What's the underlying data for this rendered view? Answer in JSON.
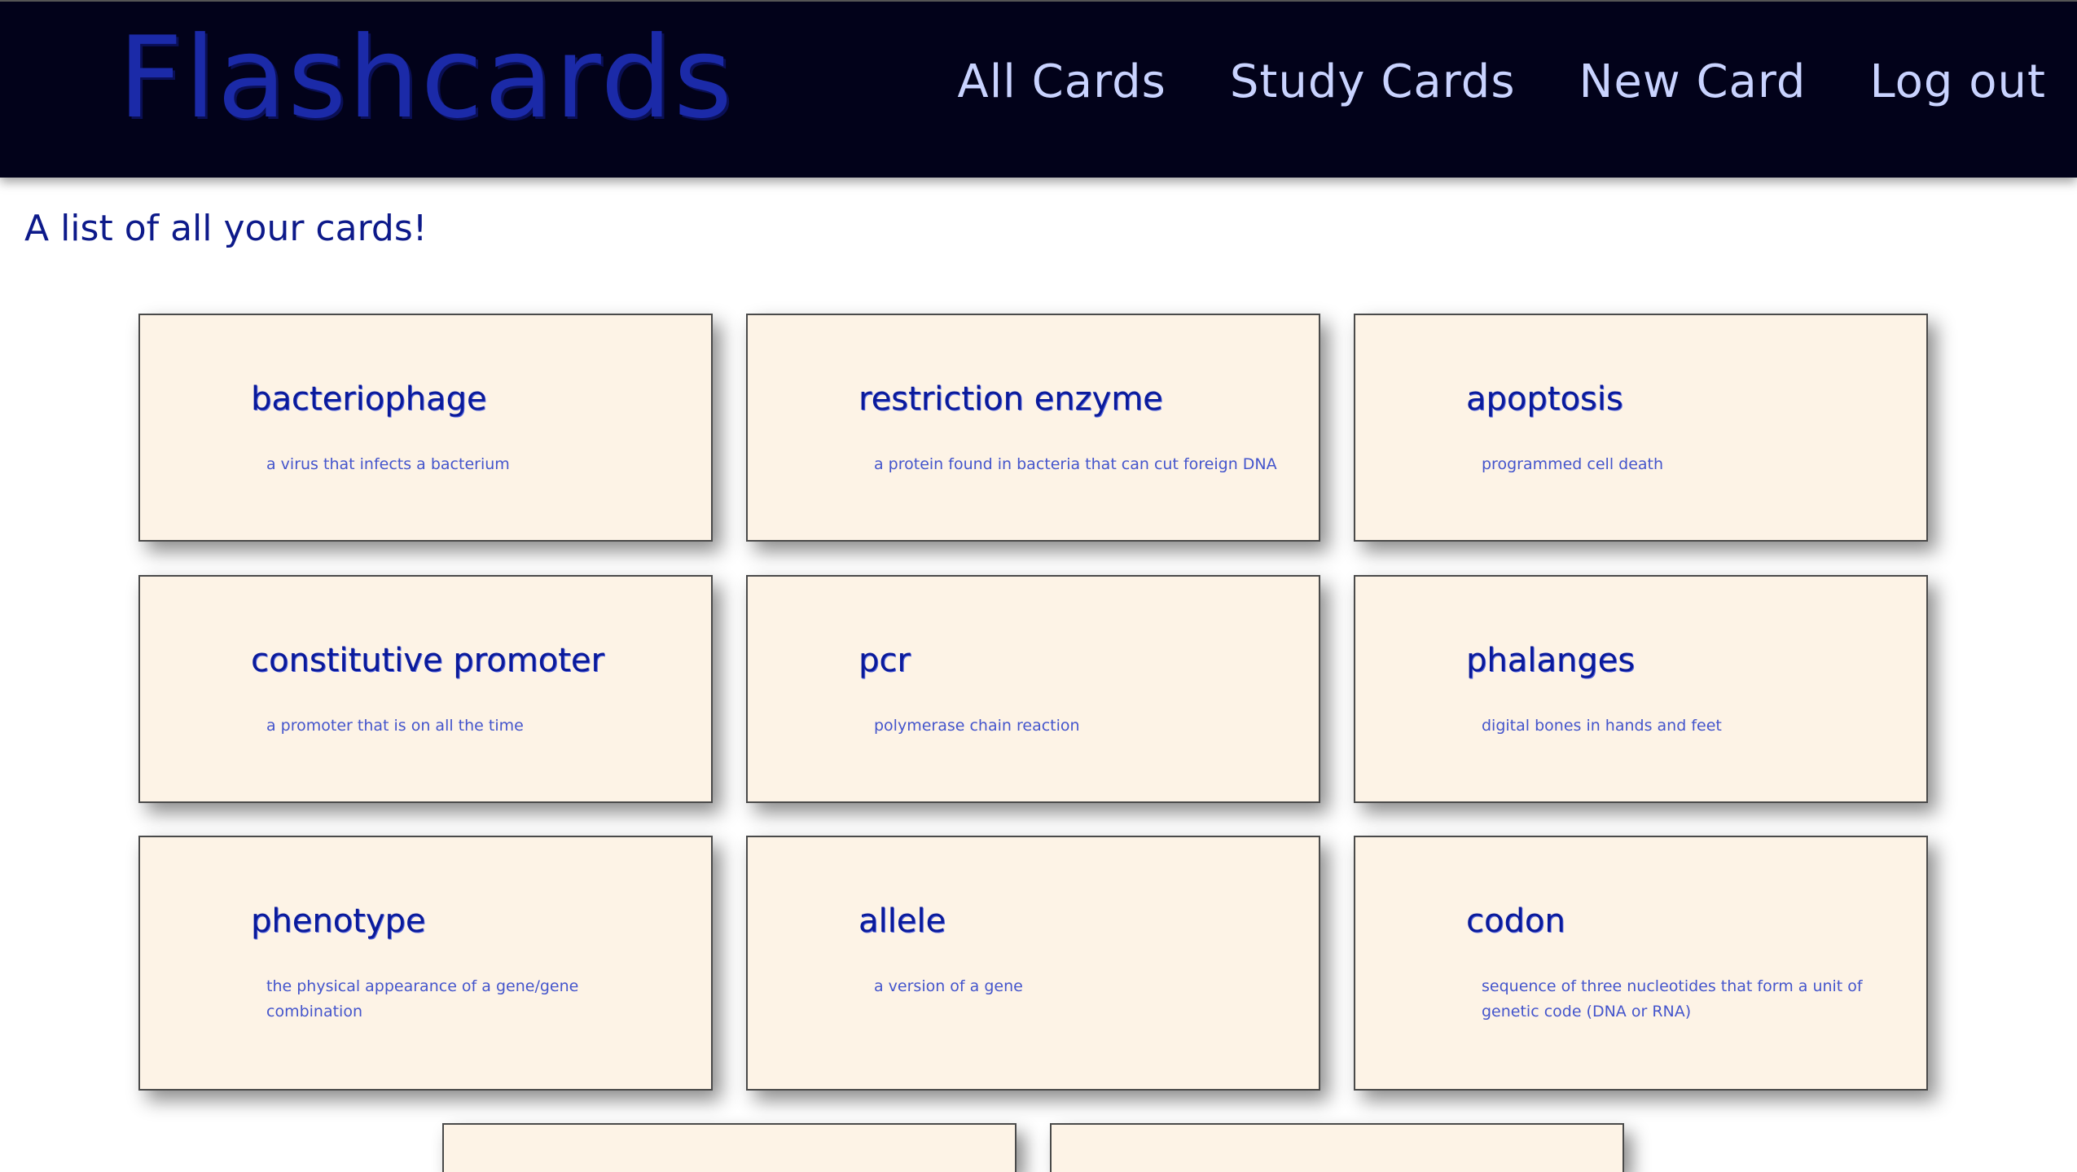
{
  "header": {
    "logo": "Flashcards",
    "nav": [
      "All Cards",
      "Study Cards",
      "New Card",
      "Log out"
    ]
  },
  "main": {
    "title": "A list of all your cards!",
    "cards": [
      {
        "term": "bacteriophage",
        "definition": "a virus that infects a bacterium"
      },
      {
        "term": "restriction enzyme",
        "definition": "a protein found in bacteria that can cut foreign DNA"
      },
      {
        "term": "apoptosis",
        "definition": "programmed cell death"
      },
      {
        "term": "constitutive promoter",
        "definition": "a promoter that is on all the time"
      },
      {
        "term": "pcr",
        "definition": "polymerase chain reaction"
      },
      {
        "term": "phalanges",
        "definition": "digital bones in hands and feet"
      },
      {
        "term": "phenotype",
        "definition": "the physical appearance of a gene/gene combination"
      },
      {
        "term": "allele",
        "definition": "a version of a gene"
      },
      {
        "term": "codon",
        "definition": "sequence of three nucleotides that form a unit of genetic code (DNA or RNA)"
      },
      {
        "term": "",
        "definition": ""
      },
      {
        "term": "",
        "definition": ""
      }
    ]
  },
  "colors": {
    "header_bg": "#02021a",
    "logo": "#1b2aa8",
    "nav_link": "#c9d3ff",
    "card_bg": "#fdf3e6",
    "term": "#0a1a9a",
    "definition": "#4455cc"
  }
}
